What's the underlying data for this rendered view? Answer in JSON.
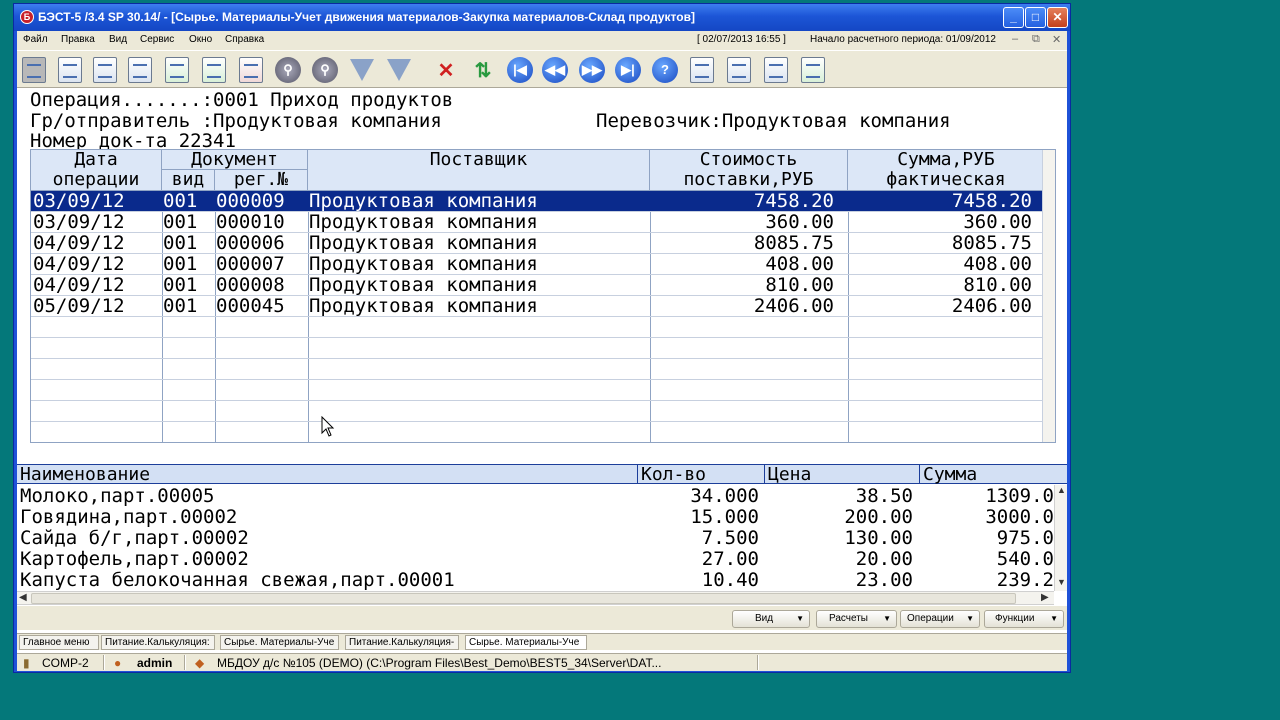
{
  "window": {
    "title": "БЭСТ-5 /3.4 SP 30.14/ - [Сырье. Материалы-Учет движения материалов-Закупка материалов-Склад продуктов]",
    "logo_letter": "Б"
  },
  "menu": {
    "items": [
      "Файл",
      "Правка",
      "Вид",
      "Сервис",
      "Окно",
      "Справка"
    ],
    "datetime": "[ 02/07/2013 16:55 ]",
    "period": "Начало расчетного периода: 01/09/2012"
  },
  "header": {
    "operation": "Операция.......:0001 Приход продуктов",
    "sender": "Гр/отправитель :Продуктовая компания",
    "carrier": "Перевозчик:Продуктовая компания",
    "doc_number": "Номер док-та 22341"
  },
  "grid": {
    "columns": {
      "date": [
        "Дата",
        "операции"
      ],
      "document": "Документ",
      "kind": "вид",
      "reg": "рег.№",
      "supplier": "Поставщик",
      "cost": [
        "Стоимость",
        "поставки,РУБ"
      ],
      "sum": [
        "Сумма,РУБ",
        "фактическая"
      ]
    },
    "rows": [
      {
        "date": "03/09/12",
        "kind": "001",
        "reg": "000009",
        "supplier": "Продуктовая компания",
        "cost": "7458.20",
        "sum": "7458.20"
      },
      {
        "date": "03/09/12",
        "kind": "001",
        "reg": "000010",
        "supplier": "Продуктовая компания",
        "cost": "360.00",
        "sum": "360.00"
      },
      {
        "date": "04/09/12",
        "kind": "001",
        "reg": "000006",
        "supplier": "Продуктовая компания",
        "cost": "8085.75",
        "sum": "8085.75"
      },
      {
        "date": "04/09/12",
        "kind": "001",
        "reg": "000007",
        "supplier": "Продуктовая компания",
        "cost": "408.00",
        "sum": "408.00"
      },
      {
        "date": "04/09/12",
        "kind": "001",
        "reg": "000008",
        "supplier": "Продуктовая компания",
        "cost": "810.00",
        "sum": "810.00"
      },
      {
        "date": "05/09/12",
        "kind": "001",
        "reg": "000045",
        "supplier": "Продуктовая компания",
        "cost": "2406.00",
        "sum": "2406.00"
      }
    ]
  },
  "detail": {
    "columns": {
      "name": "Наименование",
      "qty": "Кол-во",
      "price": "Цена",
      "sum": "Сумма"
    },
    "rows": [
      {
        "name": "Молоко,парт.00005",
        "qty": "34.000",
        "price": "38.50",
        "sum": "1309.0"
      },
      {
        "name": "Говядина,парт.00002",
        "qty": "15.000",
        "price": "200.00",
        "sum": "3000.0"
      },
      {
        "name": "Сайда б/г,парт.00002",
        "qty": "7.500",
        "price": "130.00",
        "sum": "975.0"
      },
      {
        "name": "Картофель,парт.00002",
        "qty": "27.00",
        "price": "20.00",
        "sum": "540.0"
      },
      {
        "name": "Капуста белокочанная свежая,парт.00001",
        "qty": "10.40",
        "price": "23.00",
        "sum": "239.2"
      }
    ]
  },
  "buttons": {
    "view": "Вид",
    "calc": "Расчеты",
    "ops": "Операции",
    "funcs": "Функции"
  },
  "tabs": [
    "Главное меню",
    "Питание.Калькуляция:",
    "Сырье. Материалы-Уче",
    "Питание.Калькуляция-",
    "Сырье. Материалы-Уче"
  ],
  "status": {
    "computer": "COMP-2",
    "user": "admin",
    "org": "МБДОУ д/с №105 (DEMO) (C:\\Program Files\\Best_Demo\\BEST5_34\\Server\\DAT..."
  },
  "colors": {
    "desktop": "#04787a",
    "selection": "#0a2a8c",
    "titlebar": "#1c55d6"
  }
}
